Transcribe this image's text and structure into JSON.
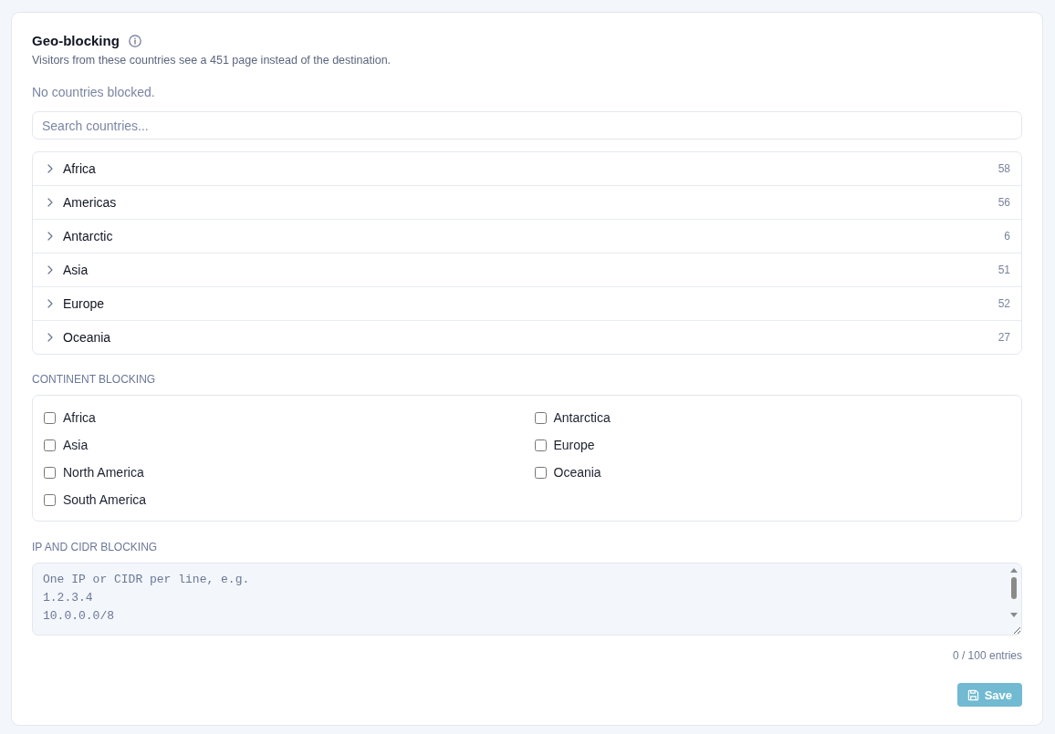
{
  "panel": {
    "title": "Geo-blocking",
    "description": "Visitors from these countries see a 451 page instead of the destination.",
    "empty_message": "No countries blocked."
  },
  "search": {
    "placeholder": "Search countries..."
  },
  "regions": [
    {
      "name": "Africa",
      "count": "58",
      "expanded": false
    },
    {
      "name": "Americas",
      "count": "56",
      "expanded": false
    },
    {
      "name": "Antarctic",
      "count": "6",
      "expanded": false
    },
    {
      "name": "Asia",
      "count": "51",
      "expanded": false
    },
    {
      "name": "Europe",
      "count": "52",
      "expanded": false
    },
    {
      "name": "Oceania",
      "count": "27",
      "expanded": false
    }
  ],
  "continent_blocking": {
    "heading": "CONTINENT BLOCKING",
    "options": [
      {
        "label": "Africa",
        "checked": false
      },
      {
        "label": "Antarctica",
        "checked": false
      },
      {
        "label": "Asia",
        "checked": false
      },
      {
        "label": "Europe",
        "checked": false
      },
      {
        "label": "North America",
        "checked": false
      },
      {
        "label": "Oceania",
        "checked": false
      },
      {
        "label": "South America",
        "checked": false
      }
    ]
  },
  "ip_blocking": {
    "heading": "IP AND CIDR BLOCKING",
    "placeholder": "One IP or CIDR per line, e.g.\n1.2.3.4\n10.0.0.0/8",
    "counter": "0 / 100 entries"
  },
  "save_button": {
    "label": "Save",
    "disabled": true
  }
}
